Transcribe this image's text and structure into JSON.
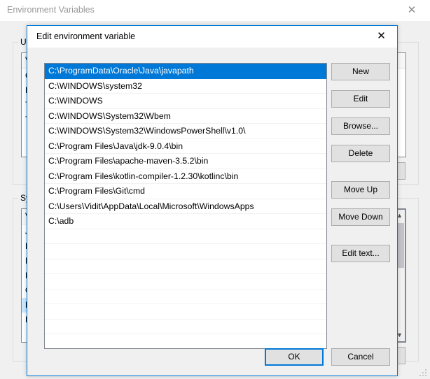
{
  "background_window": {
    "title": "Environment Variables",
    "close_icon": "close-icon",
    "user_group": {
      "label": "User",
      "header": "Va",
      "rows": [
        "On",
        "Pa",
        "TE",
        "TM"
      ]
    },
    "system_group": {
      "label": "Syste",
      "header": "Va",
      "rows": [
        "JA",
        "KO",
        "M",
        "NU",
        "OS",
        "Pa",
        "PA"
      ],
      "selected_row": "Pa"
    },
    "scrollbar": {
      "up_arrow": "chevron-up-icon",
      "down_arrow": "chevron-down-icon"
    },
    "resize_grip": "resize-grip-icon"
  },
  "dialog": {
    "title": "Edit environment variable",
    "close_icon": "close-icon",
    "paths": [
      "C:\\ProgramData\\Oracle\\Java\\javapath",
      "C:\\WINDOWS\\system32",
      "C:\\WINDOWS",
      "C:\\WINDOWS\\System32\\Wbem",
      "C:\\WINDOWS\\System32\\WindowsPowerShell\\v1.0\\",
      "C:\\Program Files\\Java\\jdk-9.0.4\\bin",
      "C:\\Program Files\\apache-maven-3.5.2\\bin",
      "C:\\Program Files\\kotlin-compiler-1.2.30\\kotlinc\\bin",
      "C:\\Program Files\\Git\\cmd",
      "C:\\Users\\Vidit\\AppData\\Local\\Microsoft\\WindowsApps",
      "C:\\adb"
    ],
    "selected_index": 0,
    "buttons": {
      "new": "New",
      "edit": "Edit",
      "browse": "Browse...",
      "delete": "Delete",
      "move_up": "Move Up",
      "move_down": "Move Down",
      "edit_text": "Edit text...",
      "ok": "OK",
      "cancel": "Cancel"
    }
  },
  "colors": {
    "selection_blue": "#0078d7",
    "dialog_border": "#0078d7",
    "face": "#f0f0f0",
    "button_face": "#e1e1e1"
  }
}
